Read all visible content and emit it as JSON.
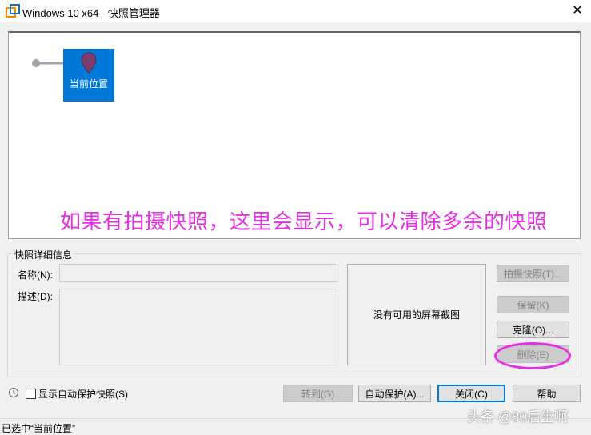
{
  "window": {
    "title": "Windows 10 x64 - 快照管理器",
    "close": "✕"
  },
  "tree": {
    "current_node": "当前位置",
    "hint": "如果有拍摄快照，这里会显示，可以清除多余的快照"
  },
  "details": {
    "group_title": "快照详细信息",
    "name_label": "名称(N):",
    "name_value": "",
    "desc_label": "描述(D):",
    "desc_value": "",
    "screenshot_text": "没有可用的屏幕截图"
  },
  "buttons": {
    "take": "拍摄快照(T)...",
    "keep": "保留(K)",
    "clone": "克隆(O)...",
    "delete": "删除(E)",
    "goto": "转到(G)",
    "autoprotect": "自动保护(A)...",
    "close": "关闭(C)",
    "help": "帮助"
  },
  "options": {
    "show_autoprotect": "显示自动保护快照(S)",
    "show_autoprotect_checked": false
  },
  "status": "已选中“当前位置”",
  "watermark": "头条 @80后生啊",
  "colors": {
    "accent": "#0078d7",
    "annotation": "#e62ee6"
  }
}
